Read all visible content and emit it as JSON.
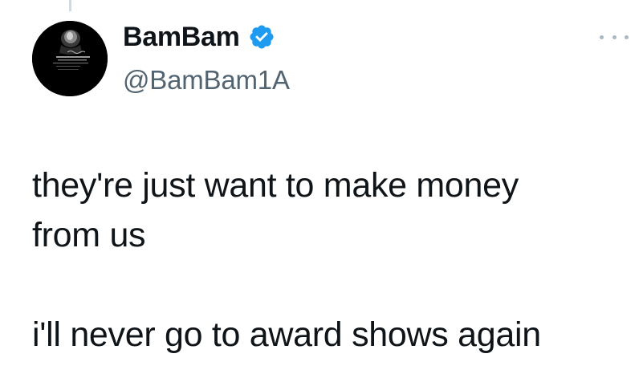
{
  "author": {
    "display_name": "BamBam",
    "handle": "@BamBam1A",
    "verified": true,
    "verified_color": "#1d9bf0"
  },
  "menu": {
    "icon": "more-dots-icon"
  },
  "tweet": {
    "paragraph_1_line_1": "they're just want to make money",
    "paragraph_1_line_2": "from us",
    "paragraph_2": "i'll never go to award shows again"
  },
  "colors": {
    "text_primary": "#0f1419",
    "text_secondary": "#536471",
    "thread_line": "#cfd9de"
  }
}
